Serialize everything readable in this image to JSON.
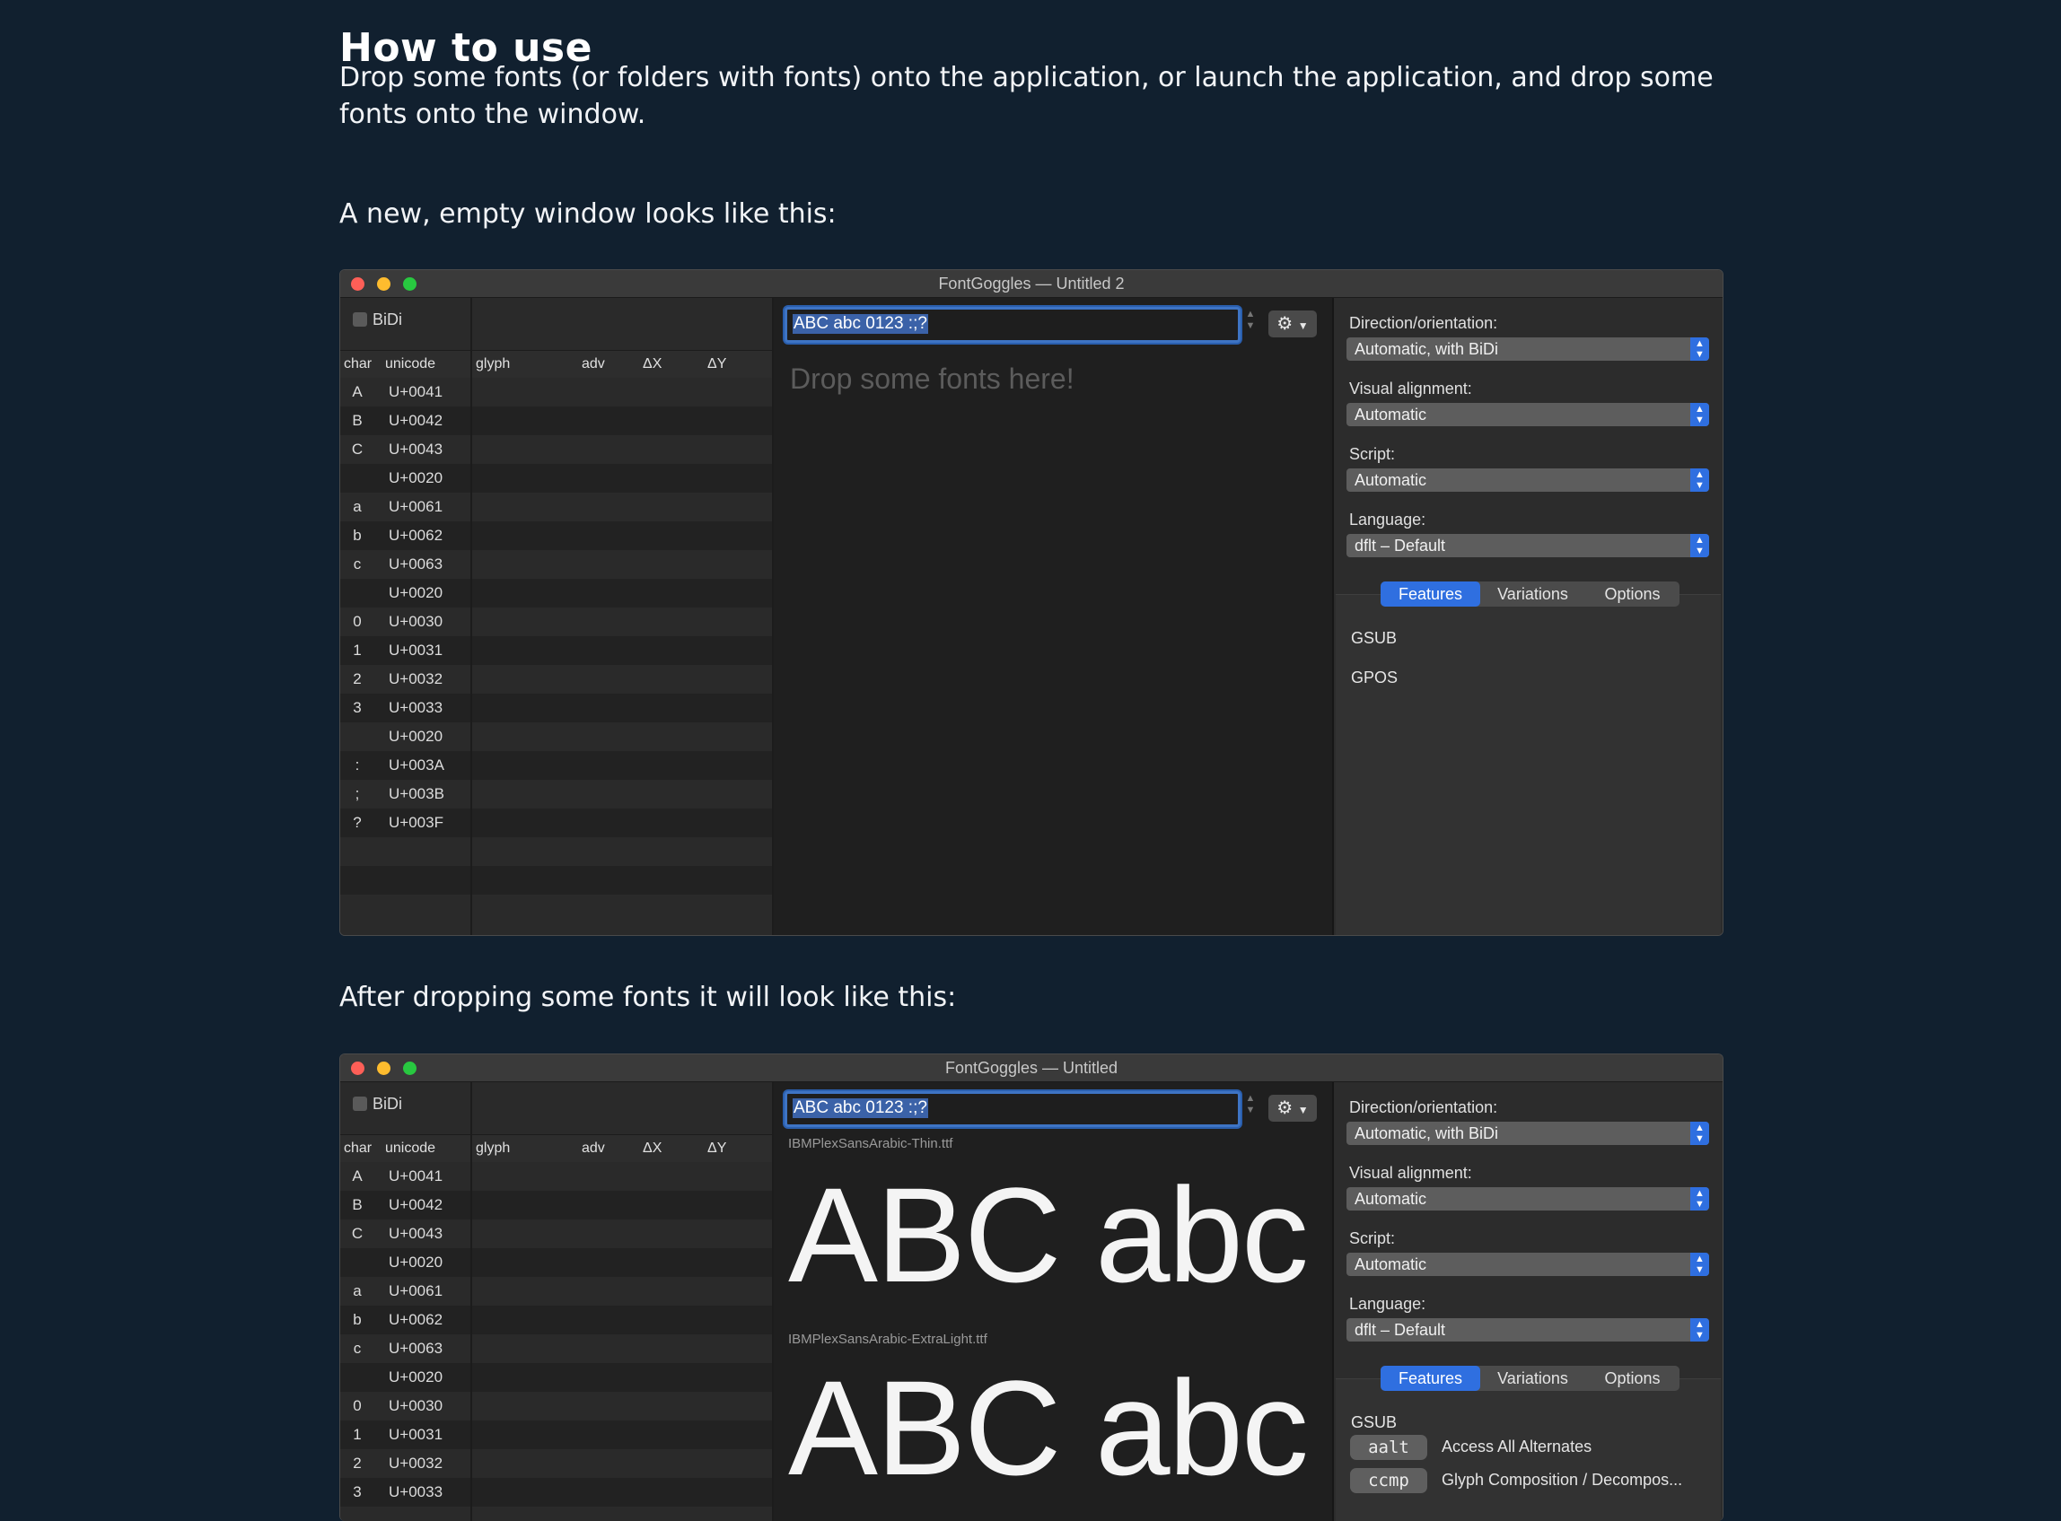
{
  "article": {
    "heading": "How to use",
    "para1": "Drop some fonts (or folders with fonts) onto the application, or launch the application, and drop some fonts onto the window.",
    "para2": "A new, empty window looks like this:",
    "para3": "After dropping some fonts it will look like this:"
  },
  "window1": {
    "title": "FontGoggles — Untitled 2",
    "bidi_label": "BiDi",
    "headers": {
      "char": "char",
      "unicode": "unicode",
      "glyph": "glyph",
      "adv": "adv",
      "dx": "ΔX",
      "dy": "ΔY"
    },
    "text_value": "ABC abc 0123 :;?",
    "placeholder": "Drop some fonts here!",
    "direction_label": "Direction/orientation:",
    "direction_value": "Automatic, with BiDi",
    "alignment_label": "Visual alignment:",
    "alignment_value": "Automatic",
    "script_label": "Script:",
    "script_value": "Automatic",
    "language_label": "Language:",
    "language_value": "dflt – Default",
    "tabs": [
      "Features",
      "Variations",
      "Options"
    ],
    "gsub": "GSUB",
    "gpos": "GPOS"
  },
  "window2": {
    "title": "FontGoggles — Untitled",
    "font1_name": "IBMPlexSansArabic-Thin.ttf",
    "font2_name": "IBMPlexSansArabic-ExtraLight.ttf",
    "sample_text": "ABC abc",
    "features": [
      {
        "tag": "aalt",
        "desc": "Access All Alternates"
      },
      {
        "tag": "ccmp",
        "desc": "Glyph Composition / Decompos..."
      }
    ]
  },
  "rows": [
    {
      "char": "A",
      "code": "U+0041"
    },
    {
      "char": "B",
      "code": "U+0042"
    },
    {
      "char": "C",
      "code": "U+0043"
    },
    {
      "char": "",
      "code": "U+0020"
    },
    {
      "char": "a",
      "code": "U+0061"
    },
    {
      "char": "b",
      "code": "U+0062"
    },
    {
      "char": "c",
      "code": "U+0063"
    },
    {
      "char": "",
      "code": "U+0020"
    },
    {
      "char": "0",
      "code": "U+0030"
    },
    {
      "char": "1",
      "code": "U+0031"
    },
    {
      "char": "2",
      "code": "U+0032"
    },
    {
      "char": "3",
      "code": "U+0033"
    },
    {
      "char": "",
      "code": "U+0020"
    },
    {
      "char": ":",
      "code": "U+003A"
    },
    {
      "char": ";",
      "code": "U+003B"
    },
    {
      "char": "?",
      "code": "U+003F"
    }
  ],
  "icons": {
    "gear": "gear-icon",
    "popup_arrows": "chevron-updown-icon",
    "checkbox": "checkbox-icon"
  },
  "colors": {
    "page_bg": "#11202f",
    "accent": "#2f6fe0",
    "close": "#fe5f57",
    "minimize": "#febc2e",
    "zoom": "#28c840"
  }
}
